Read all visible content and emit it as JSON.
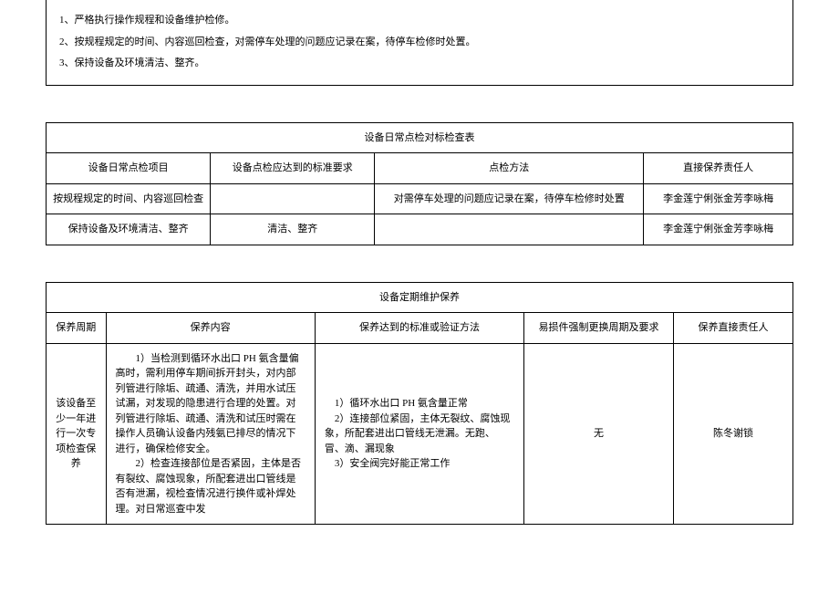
{
  "topBox": {
    "line1": "1、严格执行操作规程和设备维护检修。",
    "line2": "2、按规程规定的时间、内容巡回检查，对需停车处理的问题应记录在案，待停车检修时处置。",
    "line3": "3、保持设备及环境清洁、整齐。"
  },
  "table1": {
    "title": "设备日常点检对标检查表",
    "headers": {
      "col1": "设备日常点检项目",
      "col2": "设备点检应达到的标准要求",
      "col3": "点检方法",
      "col4": "直接保养责任人"
    },
    "rows": [
      {
        "c1": "按规程规定的时间、内容巡回检查",
        "c2": "",
        "c3": "对需停车处理的问题应记录在案，待停车检修时处置",
        "c4": "李金莲宁俐张金芳李咏梅"
      },
      {
        "c1": "保持设备及环境清洁、整齐",
        "c2": "清洁、整齐",
        "c3": "",
        "c4": "李金莲宁俐张金芳李咏梅"
      }
    ]
  },
  "table2": {
    "title": "设备定期维护保养",
    "headers": {
      "col1": "保养周期",
      "col2": "保养内容",
      "col3": "保养达到的标准或验证方法",
      "col4": "易损件强制更换周期及要求",
      "col5": "保养直接责任人"
    },
    "row": {
      "c1": "该设备至少一年进行一次专项检查保养",
      "c2": "　　1）当检测到循环水出口 PH 氨含量偏高时，需利用停车期间拆开封头，对内部列管进行除垢、疏通、清洗，并用水试压试漏，对发现的隐患进行合理的处置。对列管进行除垢、疏通、清洗和试压时需在操作人员确认设备内残氨已排尽的情况下进行，确保检修安全。\n　　2）检查连接部位是否紧固，主体是否有裂纹、腐蚀现象，所配套进出口管线是否有泄漏，视检查情况进行换件或补焊处理。对日常巡查中发",
      "c3": "　1）循环水出口 PH 氨含量正常\n　2）连接部位紧固，主体无裂纹、腐蚀现象，所配套进出口管线无泄漏。无跑、冒、滴、漏现象\n　3）安全阀完好能正常工作",
      "c4": "无",
      "c5": "陈冬谢锁"
    }
  }
}
